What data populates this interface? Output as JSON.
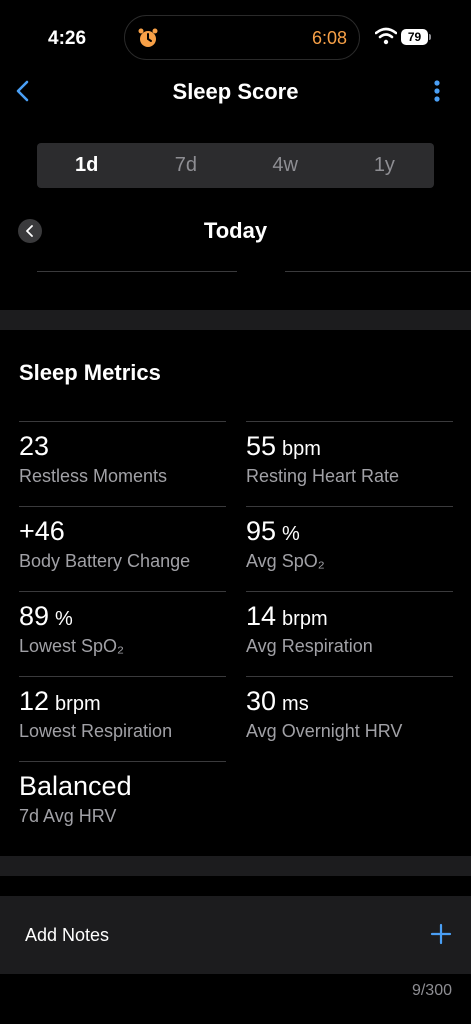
{
  "status_bar": {
    "time": "4:26",
    "alarm_time": "6:08",
    "battery_level": "79",
    "colors": {
      "alarm": "#f7a047"
    }
  },
  "nav": {
    "title": "Sleep Score",
    "back_icon": "chevron-left-icon",
    "more_icon": "more-vertical-icon"
  },
  "range_tabs": [
    {
      "label": "1d",
      "active": true
    },
    {
      "label": "7d",
      "active": false
    },
    {
      "label": "4w",
      "active": false
    },
    {
      "label": "1y",
      "active": false
    }
  ],
  "date": {
    "label": "Today"
  },
  "metrics": {
    "title": "Sleep Metrics",
    "items": [
      {
        "value": "23",
        "unit": "",
        "label": "Restless Moments"
      },
      {
        "value": "55",
        "unit": "bpm",
        "label": "Resting Heart Rate"
      },
      {
        "value": "+46",
        "unit": "",
        "label": "Body Battery Change"
      },
      {
        "value": "95",
        "unit": "%",
        "label": "Avg SpO₂"
      },
      {
        "value": "89",
        "unit": "%",
        "label": "Lowest SpO₂"
      },
      {
        "value": "14",
        "unit": "brpm",
        "label": "Avg Respiration"
      },
      {
        "value": "12",
        "unit": "brpm",
        "label": "Lowest Respiration"
      },
      {
        "value": "30",
        "unit": "ms",
        "label": "Avg Overnight HRV"
      },
      {
        "value": "Balanced",
        "unit": "",
        "label": "7d Avg HRV"
      }
    ]
  },
  "notes": {
    "label": "Add Notes",
    "add_icon": "plus-icon",
    "counter": "9/300"
  },
  "colors": {
    "accent": "#4a9ff5",
    "background": "#000000",
    "card": "#1c1c1e"
  }
}
